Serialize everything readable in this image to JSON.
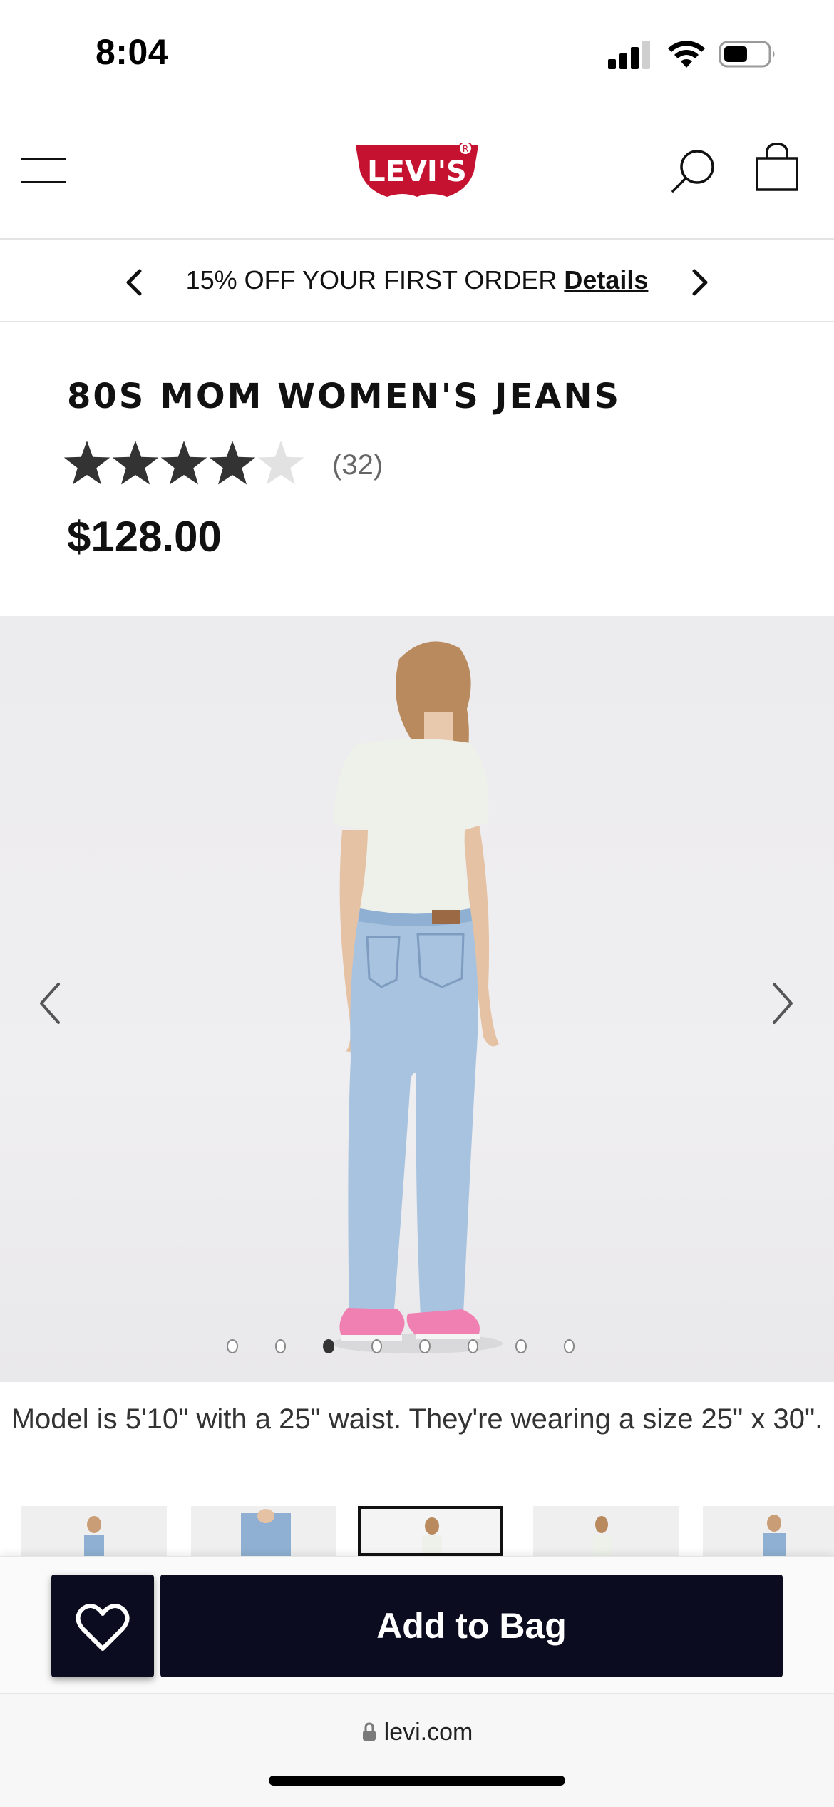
{
  "status_bar": {
    "time": "8:04",
    "battery_level": 0.55
  },
  "header": {
    "logo_text": "LEVI'S",
    "logo_color": "#c41230"
  },
  "promo": {
    "text": "15% OFF YOUR FIRST ORDER",
    "link_label": "Details"
  },
  "product": {
    "title": "80S MOM WOMEN'S JEANS",
    "rating": 4,
    "rating_max": 5,
    "review_count": "(32)",
    "price": "$128.00"
  },
  "gallery": {
    "image_count": 8,
    "active_index": 2,
    "caption": "Model is 5'10\" with a 25\" waist. They're wearing a size 25\" x 30\".",
    "thumbnails_selected": 2,
    "thumbnail_count": 5
  },
  "actions": {
    "wishlist_icon": "heart-icon",
    "add_to_bag_label": "Add to Bag"
  },
  "browser": {
    "url": "levi.com"
  },
  "colors": {
    "primary_dark": "#0b0c1f",
    "star_filled": "#333333",
    "star_empty": "#e2e2e2"
  }
}
